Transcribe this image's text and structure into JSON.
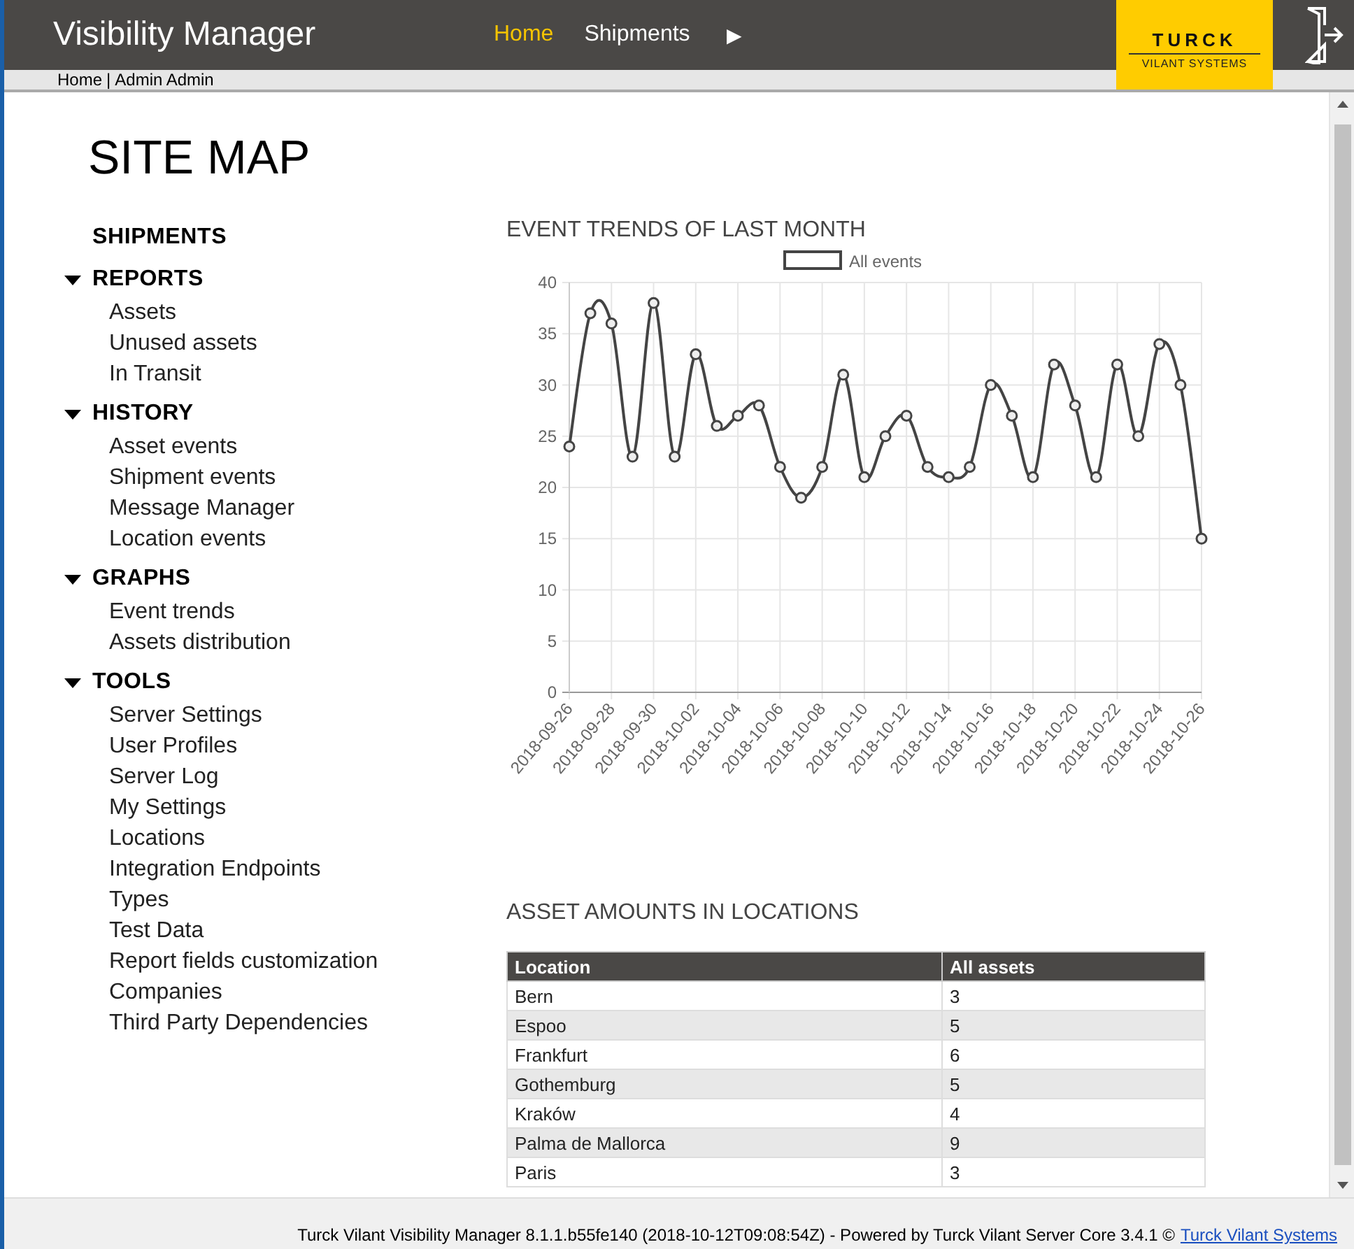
{
  "header": {
    "app_title": "Visibility Manager",
    "nav": [
      {
        "label": "Home",
        "selected": true
      },
      {
        "label": "Shipments",
        "selected": false
      }
    ],
    "nav_more": "▶",
    "logo": {
      "brand": "TURCK",
      "tagline": "VILANT SYSTEMS"
    }
  },
  "breadcrumb": {
    "items": [
      "Home",
      "Admin Admin"
    ],
    "separator": "|"
  },
  "site_map": {
    "title": "SITE MAP",
    "sections": [
      {
        "label": "SHIPMENTS",
        "expanded": false
      },
      {
        "label": "REPORTS",
        "expanded": true,
        "children": [
          {
            "label": "Assets"
          },
          {
            "label": "Unused assets"
          },
          {
            "label": "In Transit"
          }
        ]
      },
      {
        "label": "HISTORY",
        "expanded": true,
        "children": [
          {
            "label": "Asset events"
          },
          {
            "label": "Shipment events"
          },
          {
            "label": "Message Manager"
          },
          {
            "label": "Location events"
          }
        ]
      },
      {
        "label": "GRAPHS",
        "expanded": true,
        "children": [
          {
            "label": "Event trends"
          },
          {
            "label": "Assets distribution"
          }
        ]
      },
      {
        "label": "TOOLS",
        "expanded": true,
        "children": [
          {
            "label": "Server Settings"
          },
          {
            "label": "User Profiles"
          },
          {
            "label": "Server Log"
          },
          {
            "label": "My Settings"
          },
          {
            "label": "Locations"
          },
          {
            "label": "Integration Endpoints"
          },
          {
            "label": "Types"
          },
          {
            "label": "Test Data"
          },
          {
            "label": "Report fields customization"
          },
          {
            "label": "Companies"
          },
          {
            "label": "Third Party Dependencies"
          }
        ]
      }
    ]
  },
  "event_trends": {
    "title": "EVENT TRENDS OF LAST MONTH",
    "chart_data": {
      "type": "line",
      "grid": true,
      "categories": [
        "2018-09-26",
        null,
        "2018-09-28",
        null,
        "2018-09-30",
        null,
        "2018-10-02",
        null,
        "2018-10-04",
        null,
        "2018-10-06",
        null,
        "2018-10-08",
        null,
        "2018-10-10",
        null,
        "2018-10-12",
        null,
        "2018-10-14",
        null,
        "2018-10-16",
        null,
        "2018-10-18",
        null,
        "2018-10-20",
        null,
        "2018-10-22",
        null,
        "2018-10-24",
        null,
        "2018-10-26"
      ],
      "series": [
        {
          "name": "All events",
          "color": "#444444",
          "marker": "circle",
          "values": [
            24,
            37,
            36,
            23,
            38,
            23,
            33,
            26,
            27,
            28,
            22,
            19,
            22,
            31,
            21,
            25,
            27,
            22,
            21,
            22,
            30,
            27,
            21,
            32,
            28,
            21,
            32,
            25,
            34,
            30,
            15
          ]
        }
      ],
      "ylim": [
        0,
        40
      ],
      "yticks": [
        0,
        5,
        10,
        15,
        20,
        25,
        30,
        35,
        40
      ]
    }
  },
  "asset_amounts": {
    "title": "ASSET AMOUNTS IN LOCATIONS",
    "columns": [
      "Location",
      "All assets"
    ],
    "rows": [
      [
        "Bern",
        "3"
      ],
      [
        "Espoo",
        "5"
      ],
      [
        "Frankfurt",
        "6"
      ],
      [
        "Gothemburg",
        "5"
      ],
      [
        "Kraków",
        "4"
      ],
      [
        "Palma de Mallorca",
        "9"
      ],
      [
        "Paris",
        "3"
      ]
    ]
  },
  "status_bar": {
    "text": "Turck Vilant Visibility Manager 8.1.1.b55fe140 (2018-10-12T09:08:54Z) - Powered by Turck Vilant Server Core 3.4.1 ©",
    "link": "Turck Vilant Systems"
  }
}
